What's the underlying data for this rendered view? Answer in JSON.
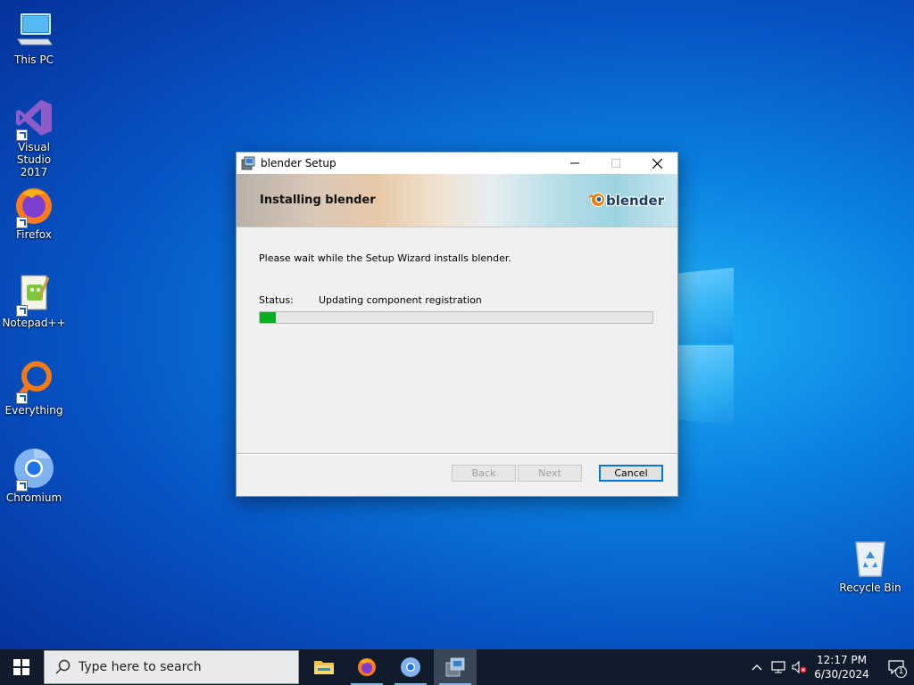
{
  "desktop": {
    "icons": [
      {
        "label": "This PC",
        "icon": "this-pc-icon"
      },
      {
        "label": "Visual Studio 2017",
        "icon": "visual-studio-icon"
      },
      {
        "label": "Firefox",
        "icon": "firefox-icon"
      },
      {
        "label": "Notepad++",
        "icon": "notepad-plus-plus-icon"
      },
      {
        "label": "Everything",
        "icon": "everything-search-icon"
      },
      {
        "label": "Chromium",
        "icon": "chromium-icon"
      },
      {
        "label": "Recycle Bin",
        "icon": "recycle-bin-icon"
      }
    ]
  },
  "dialog": {
    "title": "blender Setup",
    "banner_title": "Installing blender",
    "logo_text": "blender",
    "intro": "Please wait while the Setup Wizard installs blender.",
    "status_label": "Status:",
    "status_value": "Updating component registration",
    "progress_percent": 4,
    "buttons": {
      "back": "Back",
      "next": "Next",
      "cancel": "Cancel"
    }
  },
  "taskbar": {
    "search_placeholder": "Type here to search",
    "apps": [
      "file-explorer-icon",
      "firefox-icon",
      "chromium-icon",
      "installer-icon"
    ],
    "time": "12:17 PM",
    "date": "6/30/2024",
    "notification_count": "1"
  },
  "colors": {
    "progress": "#06b025",
    "accent": "#0078d7",
    "taskbar": "#101b2b"
  }
}
